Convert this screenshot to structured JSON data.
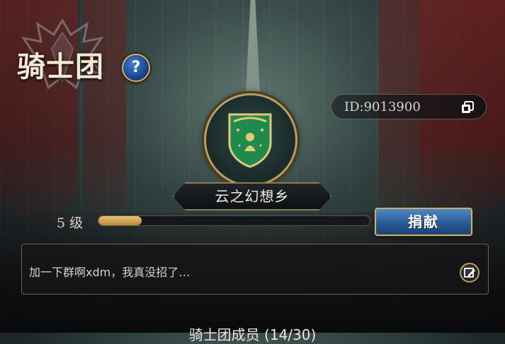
{
  "header": {
    "title": "骑士团",
    "help_icon": "question-icon",
    "help_label": "?"
  },
  "guild": {
    "id_label": "ID:9013900",
    "copy_icon": "copy-icon",
    "emblem_icon": "green-shield-emblem-icon",
    "name": "云之幻想乡",
    "level_label": "5 级",
    "level_progress_fraction": 0.16,
    "donate_label": "捐献"
  },
  "announcement": {
    "text": "加一下群啊xdm，我真没招了…",
    "edit_icon": "edit-icon"
  },
  "members": {
    "header_text": "骑士团成员 (14/30)"
  },
  "colors": {
    "accent_gold": "#c9ae70",
    "button_blue": "#295b95",
    "progress_fill": "#e8c27a",
    "emblem_green": "#1e8a4c"
  }
}
